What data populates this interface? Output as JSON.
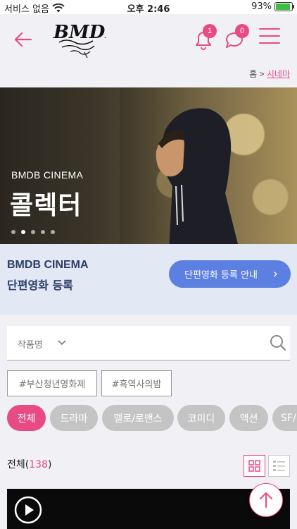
{
  "status_bar": {
    "carrier": "서비스 없음",
    "time": "오후 2:46",
    "battery": "93%",
    "battery_level": 0.93
  },
  "header": {
    "logo_text": "BMDB",
    "notification_count": "1",
    "message_count": "0"
  },
  "breadcrumb": {
    "home": "홈",
    "separator": ">",
    "current": "시네마"
  },
  "hero": {
    "subtitle": "BMDB CINEMA",
    "title": "콜렉터",
    "slide_count": 5,
    "active_slide": 2
  },
  "register": {
    "line1": "BMDB CINEMA",
    "line2": "단편영화 등록",
    "button_label": "단편영화 등록 안내",
    "button_arrow": "›"
  },
  "search": {
    "select_label": "작품명"
  },
  "hashtags": [
    "#부산청년영화제",
    "#흑역사의밤"
  ],
  "categories": [
    "전체",
    "드라마",
    "멜로/로맨스",
    "코미디",
    "액션",
    "SF/"
  ],
  "list": {
    "label": "전체",
    "count": "138"
  },
  "colors": {
    "accent": "#e84b84",
    "button_blue": "#5c7fe2",
    "banner_bg": "#e2e8f4"
  },
  "icons": [
    "back-arrow-icon",
    "bell-icon",
    "chat-icon",
    "hamburger-menu-icon",
    "search-icon",
    "chevron-down-icon",
    "grid-view-icon",
    "list-view-icon",
    "play-icon",
    "arrow-up-icon",
    "wifi-icon",
    "battery-icon"
  ]
}
